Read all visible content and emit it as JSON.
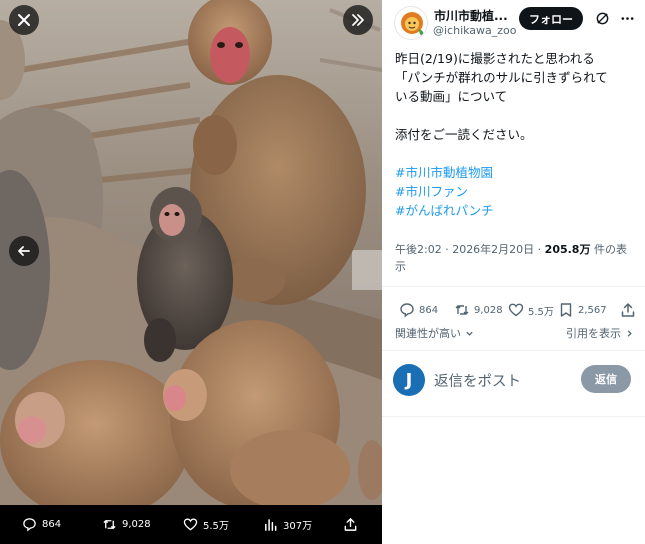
{
  "viewer": {
    "close_icon": "close-icon",
    "expand_icon": "double-chevron-right-icon",
    "prev_icon": "arrow-left-icon",
    "bar": {
      "replies": "864",
      "reposts": "9,028",
      "likes": "5.5万",
      "views": "307万"
    }
  },
  "author": {
    "name": "市川市動植...",
    "handle": "@ichikawa_zoo",
    "follow_label": "フォロー"
  },
  "post": {
    "line1": "昨日(2/19)に撮影されたと思われる",
    "line2": "「パンチが群れのサルに引きずられて",
    "line3": "いる動画」について",
    "line4": "添付をご一読ください。",
    "tag1": "#市川市動植物園",
    "tag2": "#市川ファン",
    "tag3": "#がんばれパンチ",
    "meta_time": "午後2:02 · 2026年2月20日 · ",
    "meta_views": "205.8万",
    "meta_views_suffix": " 件の表",
    "meta_line2": "示"
  },
  "actions": {
    "replies": "864",
    "reposts": "9,028",
    "likes": "5.5万",
    "bookmarks": "2,567"
  },
  "sort": {
    "relevance": "関連性が高い",
    "quotes": "引用を表示"
  },
  "reply": {
    "avatar_letter": "J",
    "placeholder": "返信をポスト",
    "button": "返信"
  },
  "colors": {
    "accent": "#1d9bf0",
    "text": "#0f1419",
    "muted": "#536471"
  }
}
